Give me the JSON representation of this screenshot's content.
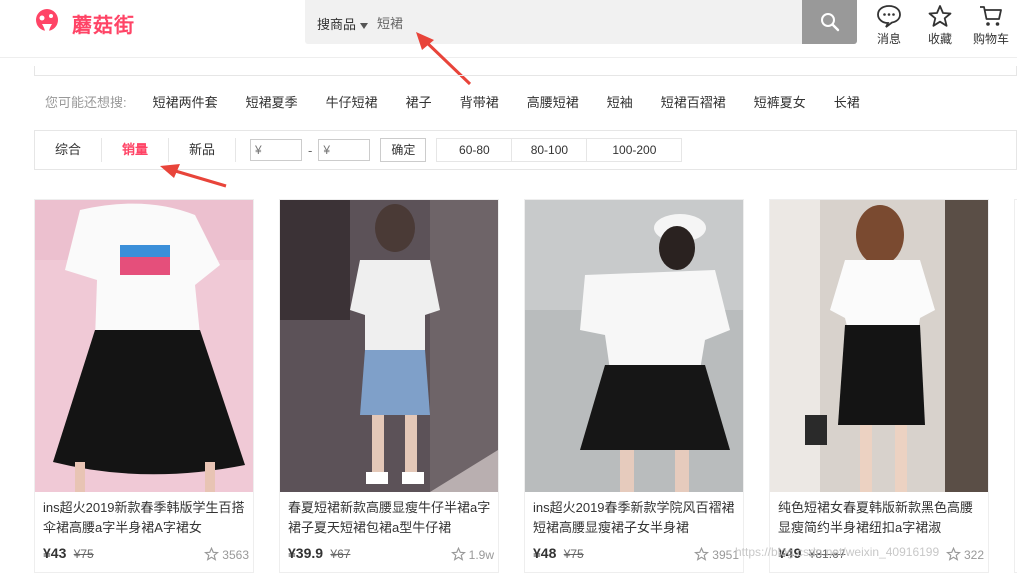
{
  "header": {
    "logo_text": "蘑菇街",
    "search_category": "搜商品",
    "search_value": "短裙",
    "icons": [
      {
        "name": "message-icon",
        "label": "消息"
      },
      {
        "name": "star-icon",
        "label": "收藏"
      },
      {
        "name": "cart-icon",
        "label": "购物车"
      }
    ]
  },
  "suggest": {
    "label": "您可能还想搜:",
    "items": [
      "短裙两件套",
      "短裙夏季",
      "牛仔短裙",
      "裙子",
      "背带裙",
      "高腰短裙",
      "短袖",
      "短裙百褶裙",
      "短裤夏女",
      "长裙"
    ]
  },
  "filter": {
    "tabs": [
      "综合",
      "销量",
      "新品"
    ],
    "active_tab": "销量",
    "price_min_placeholder": "¥",
    "price_max_placeholder": "¥",
    "range_dash": "-",
    "confirm_label": "确定",
    "ranges": [
      "60-80",
      "80-100",
      "100-200"
    ]
  },
  "products": [
    {
      "title": "ins超火2019新款春季韩版学生百搭伞裙高腰a字半身裙A字裙女",
      "price": "¥43",
      "old_price": "¥75",
      "favs": "3563"
    },
    {
      "title": "春夏短裙新款高腰显瘦牛仔半裙a字裙子夏天短裙包裙a型牛仔裙",
      "price": "¥39.9",
      "old_price": "¥67",
      "favs": "1.9w"
    },
    {
      "title": "ins超火2019春季新款学院风百褶裙短裙高腰显瘦裙子女半身裙",
      "price": "¥48",
      "old_price": "¥75",
      "favs": "3951"
    },
    {
      "title": "纯色短裙女春夏韩版新款黑色高腰显瘦简约半身裙纽扣a字裙淑",
      "price": "¥49",
      "old_price": "¥81.67",
      "favs": "322"
    }
  ],
  "watermark": "https://blog.csdn.net/weixin_40916199",
  "colors": {
    "brand": "#ff4466",
    "annotation_arrow": "#e8443a",
    "search_button": "#999999"
  }
}
